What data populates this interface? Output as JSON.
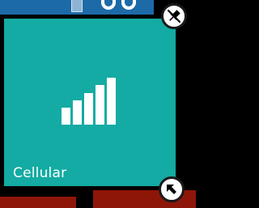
{
  "tiles": {
    "top_tile": {
      "color": "#1d6aa8"
    },
    "cellular": {
      "label": "Cellular",
      "icon": "cellular-signal-icon",
      "color": "#13aba3",
      "signal_bars_lit": 5,
      "signal_bars_total": 5
    },
    "bottom_tiles": {
      "color": "#8e1609"
    }
  },
  "edit_controls": {
    "unpin_icon": "unpin-icon",
    "resize_icon": "resize-arrow-icon"
  }
}
